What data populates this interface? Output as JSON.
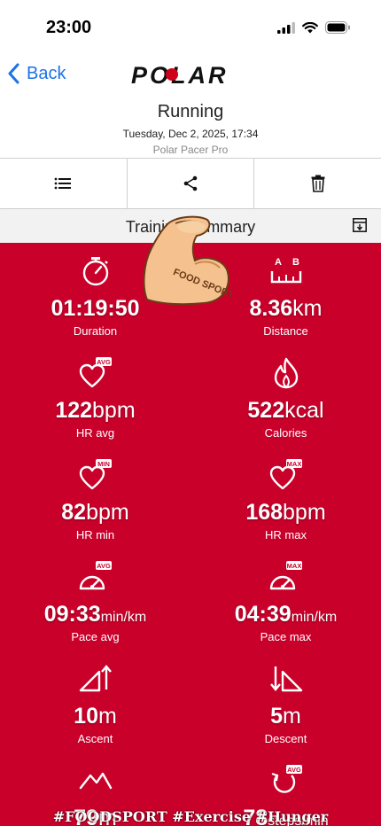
{
  "status": {
    "time": "23:00"
  },
  "nav": {
    "back_label": "Back",
    "brand": "POLAR"
  },
  "activity": {
    "title": "Running",
    "datetime": "Tuesday, Dec 2, 2025, 17:34",
    "device": "Polar Pacer Pro"
  },
  "summary": {
    "title": "Training Summary"
  },
  "stats": [
    {
      "value": "01:19:50",
      "unit": "",
      "label": "Duration",
      "icon": "stopwatch-icon"
    },
    {
      "value": "8.36",
      "unit": "km",
      "label": "Distance",
      "icon": "distance-ruler-icon"
    },
    {
      "value": "122",
      "unit": "bpm",
      "label": "HR avg",
      "icon": "heart-avg-icon"
    },
    {
      "value": "522",
      "unit": "kcal",
      "label": "Calories",
      "icon": "flame-icon"
    },
    {
      "value": "82",
      "unit": "bpm",
      "label": "HR min",
      "icon": "heart-min-icon"
    },
    {
      "value": "168",
      "unit": "bpm",
      "label": "HR max",
      "icon": "heart-max-icon"
    },
    {
      "value": "09:33",
      "unit": "min/km",
      "label": "Pace avg",
      "icon": "gauge-avg-icon"
    },
    {
      "value": "04:39",
      "unit": "min/km",
      "label": "Pace max",
      "icon": "gauge-max-icon"
    },
    {
      "value": "10",
      "unit": "m",
      "label": "Ascent",
      "icon": "ascent-icon"
    },
    {
      "value": "5",
      "unit": "m",
      "label": "Descent",
      "icon": "descent-icon"
    },
    {
      "value": "79",
      "unit": "m",
      "label": "",
      "icon": "mountain-icon"
    },
    {
      "value": "78",
      "unit": "steps/min",
      "label": "",
      "icon": "cadence-avg-icon"
    }
  ],
  "badges": {
    "avg": "AVG",
    "min": "MIN",
    "max": "MAX"
  },
  "ruler_letters": {
    "a": "A",
    "b": "B"
  },
  "watermark": "#FOODSPORT #Exercise #Hunger",
  "sticker_text": "FOOD SPORT",
  "colors": {
    "accent_red": "#c9002a",
    "link_blue": "#1a73e8"
  }
}
